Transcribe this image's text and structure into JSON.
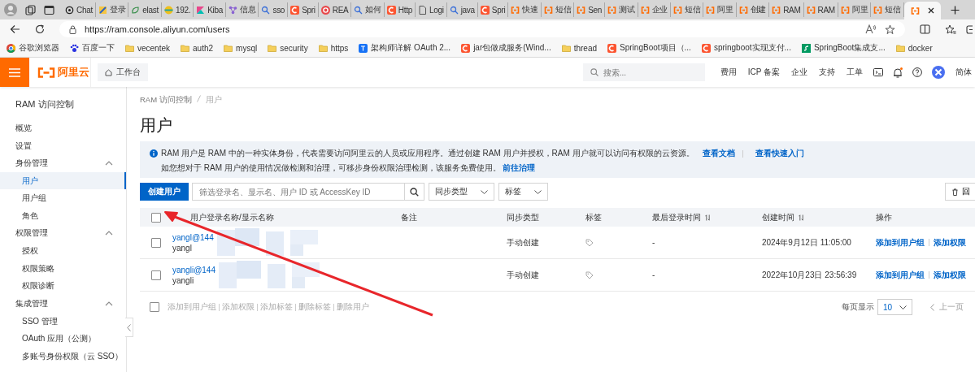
{
  "browser": {
    "tabs": [
      {
        "label": "Chat",
        "kind": "gear",
        "selected": false
      },
      {
        "label": "登录",
        "kind": "pen",
        "selected": false
      },
      {
        "label": "elast",
        "kind": "leaf",
        "selected": false
      },
      {
        "label": "192.",
        "kind": "stripes",
        "selected": false
      },
      {
        "label": "Kiba",
        "kind": "kibana",
        "selected": false
      },
      {
        "label": "信息",
        "kind": "network",
        "selected": false
      },
      {
        "label": "sso",
        "kind": "search",
        "selected": false
      },
      {
        "label": "Spri",
        "kind": "csdn",
        "selected": false
      },
      {
        "label": "REA",
        "kind": "g",
        "selected": false
      },
      {
        "label": "如何",
        "kind": "search",
        "selected": false
      },
      {
        "label": "Http",
        "kind": "csdn",
        "selected": false
      },
      {
        "label": "Logi",
        "kind": "doc",
        "selected": false
      },
      {
        "label": "java",
        "kind": "search",
        "selected": false
      },
      {
        "label": "Spri",
        "kind": "csdn",
        "selected": false
      },
      {
        "label": "快速",
        "kind": "bracket",
        "selected": false
      },
      {
        "label": "短信",
        "kind": "bracket",
        "selected": false
      },
      {
        "label": "Sen",
        "kind": "bracket",
        "selected": false
      },
      {
        "label": "测试",
        "kind": "bracket",
        "selected": false
      },
      {
        "label": "企业",
        "kind": "bracket",
        "selected": false
      },
      {
        "label": "短信",
        "kind": "bracket",
        "selected": false
      },
      {
        "label": "阿里",
        "kind": "bracket",
        "selected": false
      },
      {
        "label": "创建",
        "kind": "bracket",
        "selected": false
      },
      {
        "label": "RAM",
        "kind": "bracket",
        "selected": false
      },
      {
        "label": "RAM",
        "kind": "bracket",
        "selected": false
      },
      {
        "label": "阿里",
        "kind": "bracket",
        "selected": false
      },
      {
        "label": "短信",
        "kind": "bracket",
        "selected": false
      },
      {
        "kind": "bracket",
        "selected": true
      }
    ],
    "url": "https://ram.console.aliyun.com/users",
    "bookmarks": [
      {
        "label": "谷歌浏览器",
        "kind": "chrome"
      },
      {
        "label": "百度一下",
        "kind": "paw"
      },
      {
        "label": "vecentek",
        "kind": "folder"
      },
      {
        "label": "auth2",
        "kind": "folder"
      },
      {
        "label": "mysql",
        "kind": "folder"
      },
      {
        "label": "security",
        "kind": "folder"
      },
      {
        "label": "https",
        "kind": "folder"
      },
      {
        "label": "架构师详解 OAuth 2...",
        "kind": "zhihu"
      },
      {
        "label": "jar包做成服务(Wind...",
        "kind": "csdn"
      },
      {
        "label": "thread",
        "kind": "folder"
      },
      {
        "label": "SpringBoot项目（...",
        "kind": "csdn"
      },
      {
        "label": "springboot实现支付...",
        "kind": "csdn"
      },
      {
        "label": "SpringBoot集成支...",
        "kind": "sf"
      },
      {
        "label": "docker",
        "kind": "folder"
      }
    ]
  },
  "console_header": {
    "logo": "阿里云",
    "workbench": "工作台",
    "search": {
      "placeholder": "搜索..."
    },
    "links": [
      "费用",
      "ICP 备案",
      "企业",
      "支持",
      "工单"
    ],
    "language": "简体"
  },
  "sidebar": {
    "title": "RAM 访问控制",
    "items": [
      {
        "kind": "link",
        "label": "概览",
        "selected": false
      },
      {
        "kind": "link",
        "label": "设置",
        "selected": false
      },
      {
        "kind": "group",
        "label": "身份管理",
        "expanded": true,
        "children": [
          {
            "label": "用户",
            "selected": true
          },
          {
            "label": "用户组",
            "selected": false
          },
          {
            "label": "角色",
            "selected": false
          }
        ]
      },
      {
        "kind": "group",
        "label": "权限管理",
        "expanded": true,
        "children": [
          {
            "label": "授权",
            "selected": false
          },
          {
            "label": "权限策略",
            "selected": false
          },
          {
            "label": "权限诊断",
            "selected": false
          }
        ]
      },
      {
        "kind": "group",
        "label": "集成管理",
        "expanded": true,
        "children": [
          {
            "label": "SSO 管理",
            "selected": false
          },
          {
            "label": "OAuth 应用（公测）",
            "selected": false
          },
          {
            "label": "多账号身份权限（云 SSO）",
            "selected": false
          }
        ]
      }
    ]
  },
  "breadcrumb": [
    "RAM 访问控制",
    "用户"
  ],
  "title": "用户",
  "info": {
    "text": "RAM 用户是 RAM 中的一种实体身份，代表需要访问阿里云的人员或应用程序。通过创建 RAM 用户并授权，RAM 用户就可以访问有权限的云资源。",
    "links": [
      "查看文档",
      "查看快速入门"
    ],
    "text2": "如您想对于 RAM 用户的使用情况做检测和治理，可移步身份权限治理检测，该服务免费使用。",
    "link2": "前往治理"
  },
  "toolbar": {
    "create_button": "创建用户",
    "search": {
      "placeholder": "筛选登录名、显示名、用户 ID 或 AccessKey ID"
    },
    "filters": [
      "同步类型",
      "标签"
    ],
    "recycle_button": "回"
  },
  "table": {
    "all_checked": false,
    "columns": [
      {
        "label": "用户登录名称/显示名称",
        "sortable": false
      },
      {
        "label": "备注",
        "sortable": false
      },
      {
        "label": "同步类型",
        "sortable": false
      },
      {
        "label": "标签",
        "sortable": false
      },
      {
        "label": "最后登录时间",
        "sortable": true
      },
      {
        "label": "创建时间",
        "sortable": true
      },
      {
        "label": "操作",
        "sortable": false
      }
    ],
    "rows": [
      {
        "checked": false,
        "login_name": "yangl@144",
        "display_name": "yangl",
        "sync_type": "手动创建",
        "last_login": "-",
        "created": "2024年9月12日 11:05:00",
        "actions": [
          "添加到用户组",
          "添加权限"
        ]
      },
      {
        "checked": false,
        "login_name": "yangli@144",
        "display_name": "yangli",
        "sync_type": "手动创建",
        "last_login": "-",
        "created": "2022年10月23日 23:56:39",
        "actions": [
          "添加到用户组",
          "添加权限"
        ]
      }
    ]
  },
  "batch": {
    "checked": false,
    "actions": [
      {
        "label": "添加到用户组",
        "disabled": true
      },
      {
        "label": "添加权限",
        "disabled": true
      },
      {
        "label": "添加标签",
        "disabled": true
      },
      {
        "label": "删除标签",
        "disabled": true
      },
      {
        "label": "删除用户",
        "disabled": true
      }
    ]
  },
  "pagination": {
    "label": "每页显示",
    "page_size": "10",
    "prev": "上一页"
  }
}
